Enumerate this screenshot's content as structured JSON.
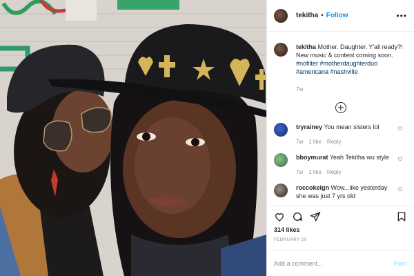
{
  "post": {
    "username": "tekitha",
    "follow_label": "Follow",
    "more_label": "•••",
    "caption": {
      "username": "tekitha",
      "text": "Mother. Daughter. Y'all ready?! New music & content coming soon.",
      "hashtags": [
        "#nofilter",
        "#motherdaughterduo",
        "#americana",
        "#nashville"
      ],
      "time_ago": "7w"
    },
    "load_more_icon": "plus-circle-icon",
    "comments": [
      {
        "username": "tryrainey",
        "text": "You mean sisters lol",
        "time_ago": "7w",
        "likes": "1 like",
        "reply": "Reply"
      },
      {
        "username": "bboymurat",
        "text": "Yeah Tekitha wu style",
        "time_ago": "7w",
        "likes": "1 like",
        "reply": "Reply"
      },
      {
        "username": "roccokeign",
        "text": "Wow...like yesterday she was just 7 yrs old",
        "time_ago": "",
        "likes": "",
        "reply": ""
      }
    ],
    "likes_count": "314 likes",
    "date": "FEBRUARY 20",
    "add_comment_placeholder": "Add a comment...",
    "post_button": "Post",
    "action_icons": [
      "heart-icon",
      "comment-icon",
      "share-icon",
      "bookmark-icon"
    ]
  }
}
